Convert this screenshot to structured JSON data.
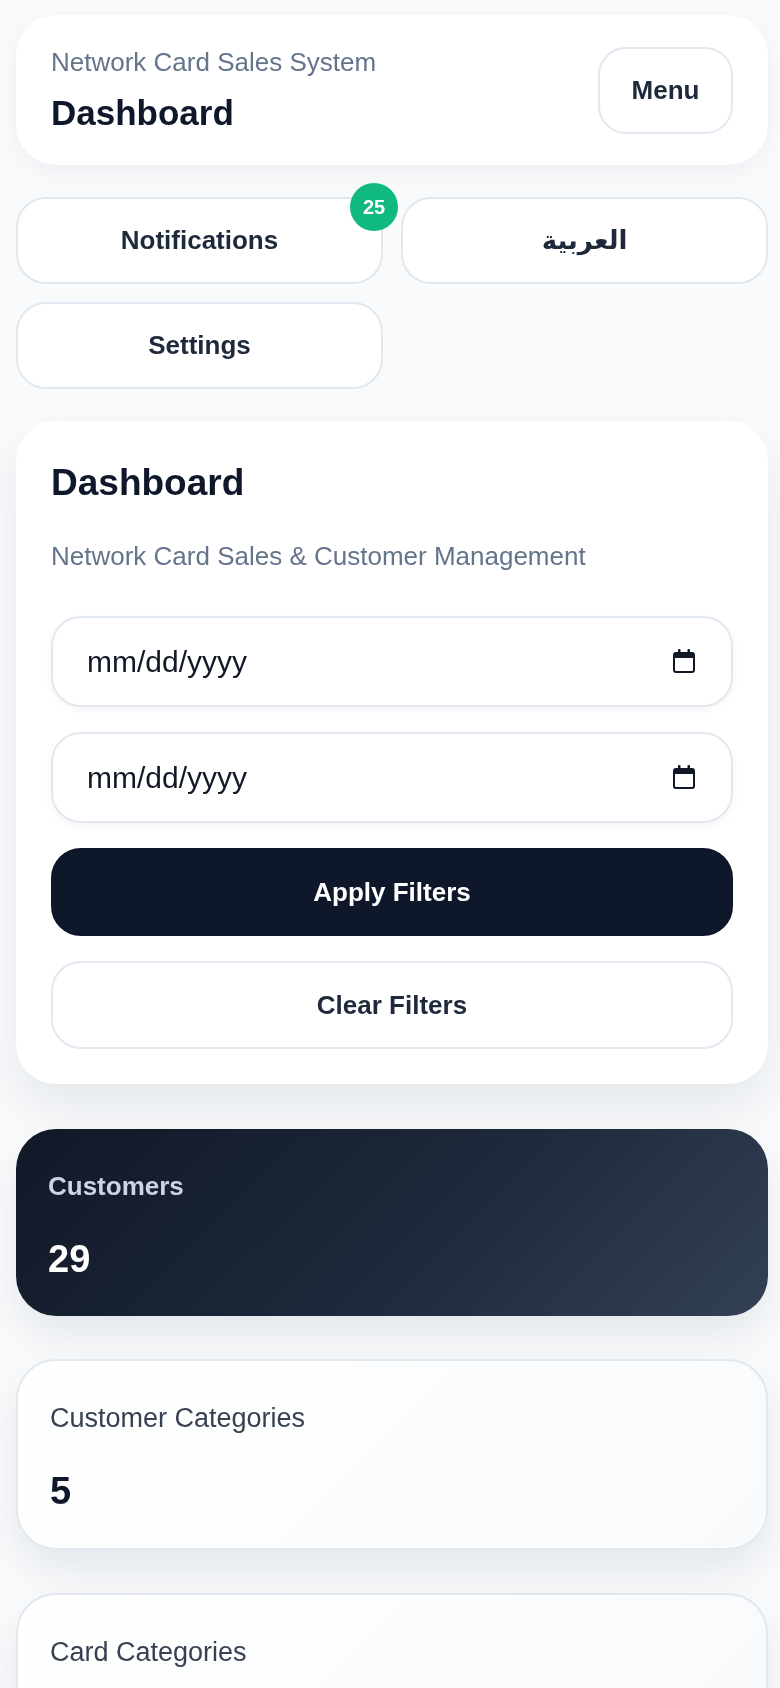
{
  "header": {
    "subtitle": "Network Card Sales System",
    "title": "Dashboard",
    "menu_button": "Menu"
  },
  "actions": [
    {
      "label": "Notifications",
      "badge": "25"
    },
    {
      "label": "العربية"
    },
    {
      "label": "Settings"
    }
  ],
  "filters": {
    "title": "Dashboard",
    "subtitle": "Network Card Sales & Customer Management",
    "date_fields": [
      {
        "placeholder": "mm/dd/yyyy"
      },
      {
        "placeholder": "mm/dd/yyyy"
      }
    ],
    "buttons": [
      {
        "label": "Apply Filters",
        "kind": "primary"
      },
      {
        "label": "Clear Filters",
        "kind": "secondary"
      }
    ]
  },
  "stats": [
    {
      "label": "Customers",
      "value": "29",
      "kind": "highlight"
    },
    {
      "label": "Customer Categories",
      "value": "5",
      "kind": "plain"
    },
    {
      "label": "Card Categories",
      "kind": "plain"
    }
  ]
}
